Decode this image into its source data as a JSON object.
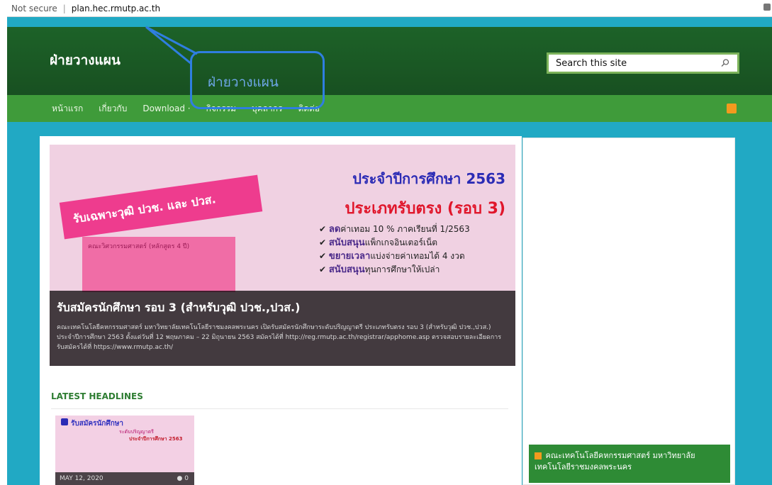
{
  "browser": {
    "security": "Not secure",
    "url": "plan.hec.rmutp.ac.th"
  },
  "header": {
    "site_title": "ฝ่ายวางแผน",
    "search_placeholder": "Search this site",
    "accent": "#3f9b3a",
    "brand_dark": "#1c5c26"
  },
  "nav": {
    "items": [
      "หน้าแรก",
      "เกี่ยวกับ",
      "Download ·",
      "กิจกรรม",
      "บุคลากร",
      "ติดต่อ"
    ]
  },
  "slider": {
    "headline_top": "ประจำปีการศึกษา 2563",
    "headline_main": "ประเภทรับตรง (รอบ 3)",
    "ribbon": "รับเฉพาะวุฒิ ปวช. และ ปวส.",
    "program": "คณะวิศวกรรมศาสตร์ (หลักสูตร 4 ปี)",
    "bullets": [
      {
        "strong": "ลด",
        "text": "ค่าเทอม 10 % ภาคเรียนที่ 1/2563"
      },
      {
        "strong": "สนับสนุน",
        "text": "แพ็กเกจอินเตอร์เน็ต"
      },
      {
        "strong": "ขยายเวลา",
        "text": "แบ่งจ่ายค่าเทอมได้ 4 งวด"
      },
      {
        "strong": "สนับสนุน",
        "text": "ทุนการศึกษาให้เปล่า"
      }
    ],
    "caption_title": "รับสมัครนักศึกษา รอบ 3 (สำหรับวุฒิ ปวช.,ปวส.)",
    "caption_desc": "คณะเทคโนโลยีคหกรรมศาสตร์ มหาวิทยาลัยเทคโนโลยีราชมงคลพระนคร เปิดรับสมัครนักศึกษาระดับปริญญาตรี ประเภทรับตรง รอบ 3 (สำหรับวุฒิ ปวช.,ปวส.) ประจำปีการศึกษา 2563 ตั้งแต่วันที่ 12 พฤษภาคม – 22 มิถุนายน 2563 สมัครได้ที่ http://reg.rmutp.ac.th/registrar/apphome.asp ตรวจสอบรายละเอียดการรับสมัครได้ที่ https://www.rmutp.ac.th/"
  },
  "latest": {
    "heading": "LATEST HEADLINES",
    "item_title": "รับสมัครนักศึกษา",
    "item_sub": "ระดับปริญญาตรี",
    "item_year": "ประจำปีการศึกษา 2563",
    "date": "MAY 12, 2020",
    "comments": "0"
  },
  "sidebar": {
    "rss_title": "คณะเทคโนโลยีคหกรรมศาสตร์ มหาวิทยาลัยเทคโนโลยีราชมงคลพระนคร"
  },
  "annotation": {
    "text": "ฝ่ายวางแผน",
    "color": "#2f7ee0"
  }
}
